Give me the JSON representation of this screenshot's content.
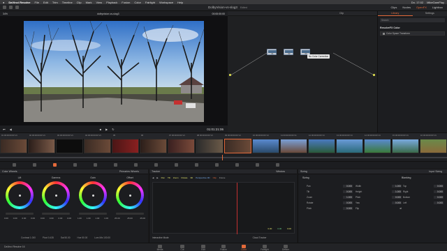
{
  "menubar": {
    "app": "DaVinci Resolve",
    "items": [
      "File",
      "Edit",
      "Trim",
      "Timeline",
      "Clip",
      "Mark",
      "View",
      "Playback",
      "Fusion",
      "Color",
      "Fairlight",
      "Workspace",
      "Help"
    ],
    "clock": "Do. 17:02",
    "user": "MikeGamPlay"
  },
  "toolbar": {
    "project_title": "DolbyVision-vs-slog3",
    "saved": "Edited",
    "clips_label": "Clips",
    "nodes_label": "Nodes",
    "effects_label": "OpenFX",
    "lightbox_label": "Lightbox"
  },
  "viewer": {
    "zoom": "34%",
    "clip_name": "dolbyvision-vs-slog3",
    "timecode_top": "00:00:00:00",
    "timecode": "01:01:21:06"
  },
  "nodes": {
    "mode": "Clip",
    "node_numbers": [
      "01",
      "02",
      "03"
    ],
    "tooltip": "No Color Correction"
  },
  "library": {
    "tabs": [
      "Library",
      "Settings"
    ],
    "search_placeholder": "Search",
    "section": "ResolveFX Color",
    "item": "Color Space Transform"
  },
  "timeline": {
    "clip_labels": [
      "01 00:00:00:00 V1",
      "02 00:00:00:00 V1",
      "03 00:00:00:00 V1",
      "04 00:00:00:00 V1",
      "05",
      "06",
      "07 00:00:00:00 V1",
      "08 00:00:00:00 V1",
      "09 00:00:00:00 V1",
      "10 00:00:00:00 V1",
      "11 00:00:00:00 V1",
      "12 00:00:00:00 V1",
      "13 00:00:00:00 V1",
      "14 00:00:00:00 V1",
      "15 00:00:00:00 V1",
      "16 00:00:00:00 V1"
    ],
    "codec": "Sony S-Log3"
  },
  "color_wheels": {
    "title": "Color Wheels",
    "mode": "Primaries Wheels",
    "wheels": [
      {
        "label": "Lift",
        "vals": [
          "0.00",
          "0.00",
          "0.00",
          "0.00"
        ]
      },
      {
        "label": "Gamma",
        "vals": [
          "0.00",
          "0.00",
          "0.00",
          "0.00"
        ]
      },
      {
        "label": "Gain",
        "vals": [
          "1.00",
          "1.00",
          "1.00",
          "1.00"
        ]
      },
      {
        "label": "Offset",
        "vals": [
          "25.00",
          "25.00",
          "25.00"
        ]
      }
    ],
    "params": [
      "Contrast 1.000",
      "Pivot 0.435",
      "Sat 50.00",
      "Hue 50.00",
      "Lum Mix 100.00"
    ]
  },
  "tracker": {
    "title": "Tracker",
    "window": "Window",
    "controls": [
      "Pan",
      "Tilt",
      "Zoom",
      "Rotate",
      "3D",
      "Perspective 3D",
      "Clip",
      "Frame"
    ],
    "interactive_mode": "Interactive Mode",
    "cloud": "Cloud Tracker",
    "values": [
      "0.00",
      "0.00",
      "0.00"
    ]
  },
  "sizing": {
    "title": "Sizing",
    "mode": "Input Sizing",
    "left_title": "Sizing",
    "right_title": "Blanking",
    "left_rows": [
      {
        "label": "Pan",
        "val": "0.000"
      },
      {
        "label": "Tilt",
        "val": "0.000"
      },
      {
        "label": "Zoom",
        "val": "1.000"
      },
      {
        "label": "Rotate",
        "val": "0.000"
      },
      {
        "label": "Pitch",
        "val": "0.000"
      }
    ],
    "mid_rows": [
      {
        "label": "Width",
        "val": "1.000"
      },
      {
        "label": "Height",
        "val": "1.000"
      },
      {
        "label": "Pitch",
        "val": "0.000"
      },
      {
        "label": "Yaw",
        "val": "0.000"
      },
      {
        "label": "Flip",
        "val": ""
      }
    ],
    "right_rows": [
      {
        "label": "Top",
        "val": "0.000"
      },
      {
        "label": "Right",
        "val": "0.000"
      },
      {
        "label": "Bottom",
        "val": "0.000"
      },
      {
        "label": "Left",
        "val": "0.000"
      }
    ]
  },
  "pages": [
    "Media",
    "Cut",
    "Edit",
    "Fusion",
    "Color",
    "Fairlight",
    "Deliver"
  ],
  "active_page": "Color",
  "footer_app": "DaVinci Resolve 16"
}
